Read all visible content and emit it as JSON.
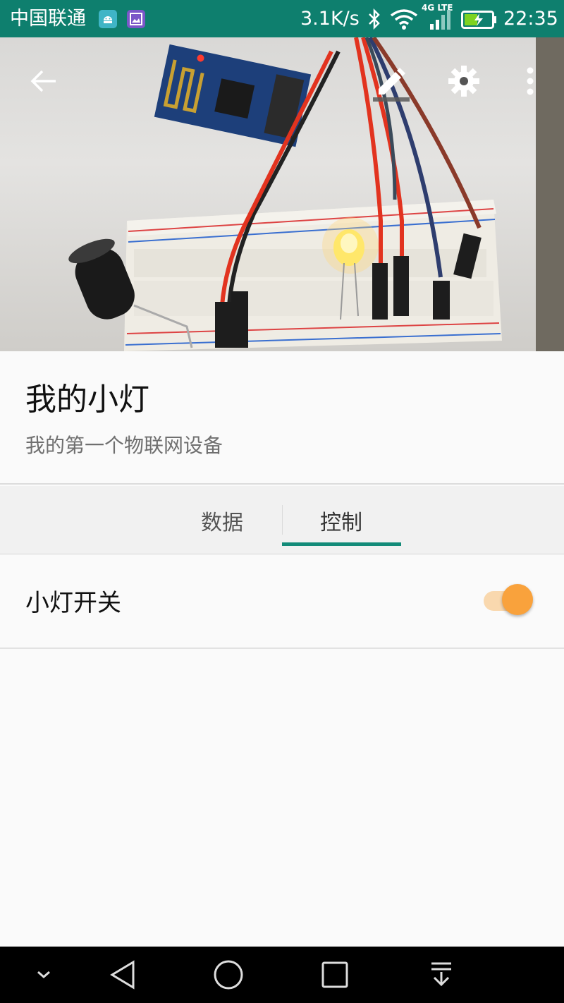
{
  "status_bar": {
    "carrier": "中国联通",
    "net_speed": "3.1K/s",
    "signal_label": "4G LTE",
    "time": "22:35",
    "icons": [
      "android-notification-icon",
      "gallery-notification-icon",
      "bluetooth-icon",
      "wifi-icon",
      "signal-icon",
      "battery-charging-icon"
    ]
  },
  "toolbar": {
    "icons": [
      "back-arrow-icon",
      "edit-pencil-icon",
      "settings-gear-icon",
      "more-vertical-icon"
    ]
  },
  "device": {
    "name": "我的小灯",
    "description": "我的第一个物联网设备"
  },
  "tabs": [
    {
      "label": "数据",
      "selected": false
    },
    {
      "label": "控制",
      "selected": true
    }
  ],
  "controls": [
    {
      "label": "小灯开关",
      "state": "on"
    }
  ],
  "colors": {
    "primary": "#0e7f6e",
    "tab_indicator": "#138b79",
    "switch_thumb": "#f9a23c",
    "switch_track": "#f9d8ae"
  },
  "nav_bar": {
    "icons": [
      "hide-navbar-chevron-icon",
      "nav-back-icon",
      "nav-home-icon",
      "nav-recents-icon",
      "notification-pull-icon"
    ]
  }
}
